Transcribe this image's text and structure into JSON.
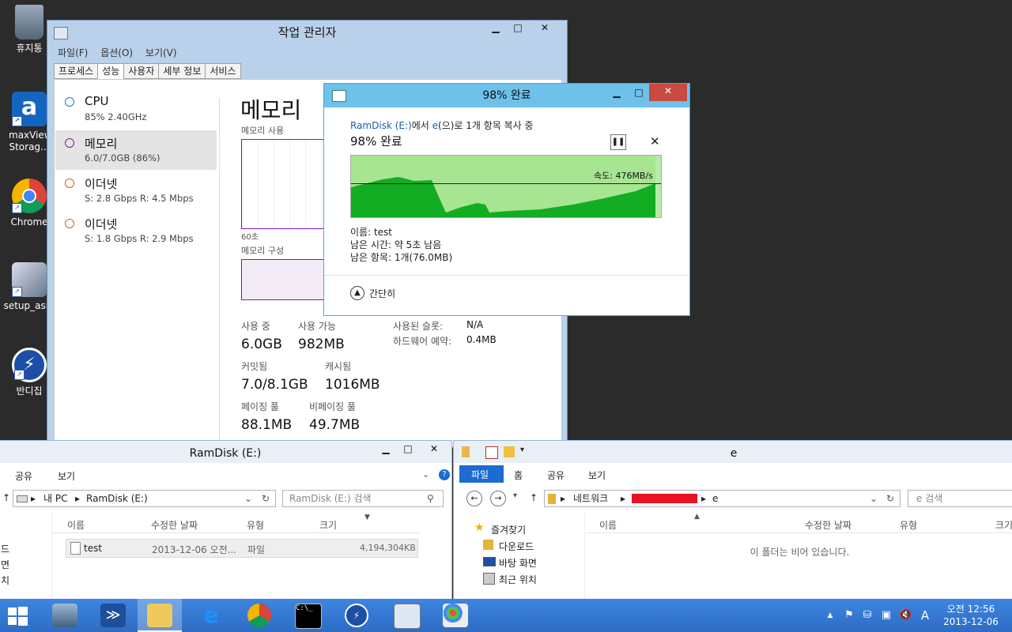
{
  "desktop": {
    "icons": [
      {
        "label": "휴지통",
        "icon": "recycle-bin-icon"
      },
      {
        "label": "maxView Storag...",
        "icon": "maxview-icon"
      },
      {
        "label": "Chrome",
        "icon": "chrome-icon"
      },
      {
        "label": "setup_asm",
        "icon": "setup-icon"
      },
      {
        "label": "반디집",
        "icon": "bandizip-icon"
      }
    ]
  },
  "taskmgr": {
    "title": "작업 관리자",
    "menu": [
      "파일(F)",
      "옵션(O)",
      "보기(V)"
    ],
    "tabs": [
      "프로세스",
      "성능",
      "사용자",
      "세부 정보",
      "서비스"
    ],
    "perf_items": [
      {
        "name": "CPU",
        "detail": "85%  2.40GHz"
      },
      {
        "name": "메모리",
        "detail": "6.0/7.0GB (86%)"
      },
      {
        "name": "이더넷",
        "detail": "S: 2.8 Gbps  R: 4.5 Mbps"
      },
      {
        "name": "이더넷",
        "detail": "S: 1.8 Gbps  R: 2.9 Mbps"
      }
    ],
    "heading": "메모리",
    "usage_label": "메모리 사용",
    "time_label": "60초",
    "composition_label": "메모리 구성",
    "stats": {
      "in_use_label": "사용 중",
      "in_use": "6.0GB",
      "available_label": "사용 가능",
      "available": "982MB",
      "slots_label": "사용된 슬롯:",
      "slots": "N/A",
      "hw_reserved_label": "하드웨어 예약:",
      "hw_reserved": "0.4MB",
      "committed_label": "커밋됨",
      "committed": "7.0/8.1GB",
      "cached_label": "캐시됨",
      "cached": "1016MB",
      "paged_label": "페이징 풀",
      "paged": "88.1MB",
      "nonpaged_label": "비페이징 풀",
      "nonpaged": "49.7MB"
    }
  },
  "copy": {
    "title": "98% 완료",
    "source": "RamDisk (E:)",
    "middle": "에서 ",
    "dest": "e",
    "suffix": "(으)로 1개 항목 복사 중",
    "percent_text": "98% 완료",
    "speed": "속도: 476MB/s",
    "name": "이름: test",
    "time_left": "남은 시간: 약 5초 남음",
    "items_left": "남은 항목: 1개(76.0MB)",
    "less_details": "간단히"
  },
  "explorer_left": {
    "title": "RamDisk (E:)",
    "ribbon": [
      "공유",
      "보기"
    ],
    "path": [
      "내 PC",
      "RamDisk (E:)"
    ],
    "search_placeholder": "RamDisk (E:) 검색",
    "columns": [
      "이름",
      "수정한 날짜",
      "유형",
      "크기"
    ],
    "nav_fragments": [
      "드",
      "면",
      "치"
    ],
    "files": [
      {
        "name": "test",
        "date": "2013-12-06 오전...",
        "type": "파일",
        "size": "4,194,304KB"
      }
    ]
  },
  "explorer_right": {
    "title": "e",
    "ribbon": [
      "파일",
      "홈",
      "공유",
      "보기"
    ],
    "path": [
      "네트워크",
      "e"
    ],
    "search_placeholder": "e 검색",
    "columns": [
      "이름",
      "수정한 날짜",
      "유형",
      "크기"
    ],
    "nav": [
      "즐겨찾기",
      "다운로드",
      "바탕 화면",
      "최근 위치"
    ],
    "empty": "이 폴더는 비어 있습니다."
  },
  "taskbar": {
    "clock_time": "오전 12:56",
    "clock_date": "2013-12-06",
    "ime": "A"
  },
  "colors": {
    "accent": "#3d86e0",
    "copy_caption": "#6dc1eb",
    "graph_fill": "#13ad23",
    "redacted": "#e81123"
  }
}
